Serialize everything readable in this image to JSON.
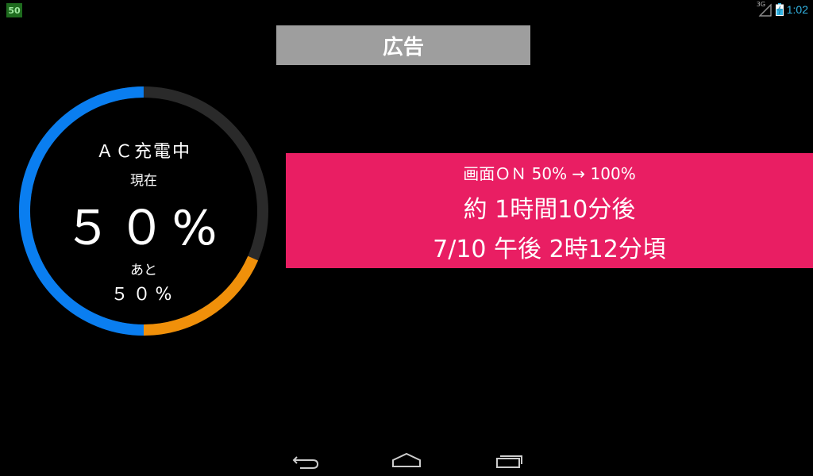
{
  "status_bar": {
    "battery_notification": "50",
    "network_type": "3G",
    "time": "1:02"
  },
  "ad": {
    "label": "広告"
  },
  "gauge": {
    "status": "ＡＣ充電中",
    "current_label": "現在",
    "current_value": "５０%",
    "remaining_label": "あと",
    "remaining_value": "５０%",
    "charged_fraction": 0.5,
    "colors": {
      "charged": "#0a7ef0",
      "remaining": "#f0900a",
      "track": "#2a2a2a"
    }
  },
  "info": {
    "mode": "画面ＯＮ 50% → 100%",
    "duration": "約 1時間10分後",
    "eta": "7/10 午後 2時12分頃",
    "background": "#e91e63"
  },
  "nav": {
    "back_icon": "back-icon",
    "home_icon": "home-icon",
    "recent_icon": "recent-apps-icon"
  }
}
